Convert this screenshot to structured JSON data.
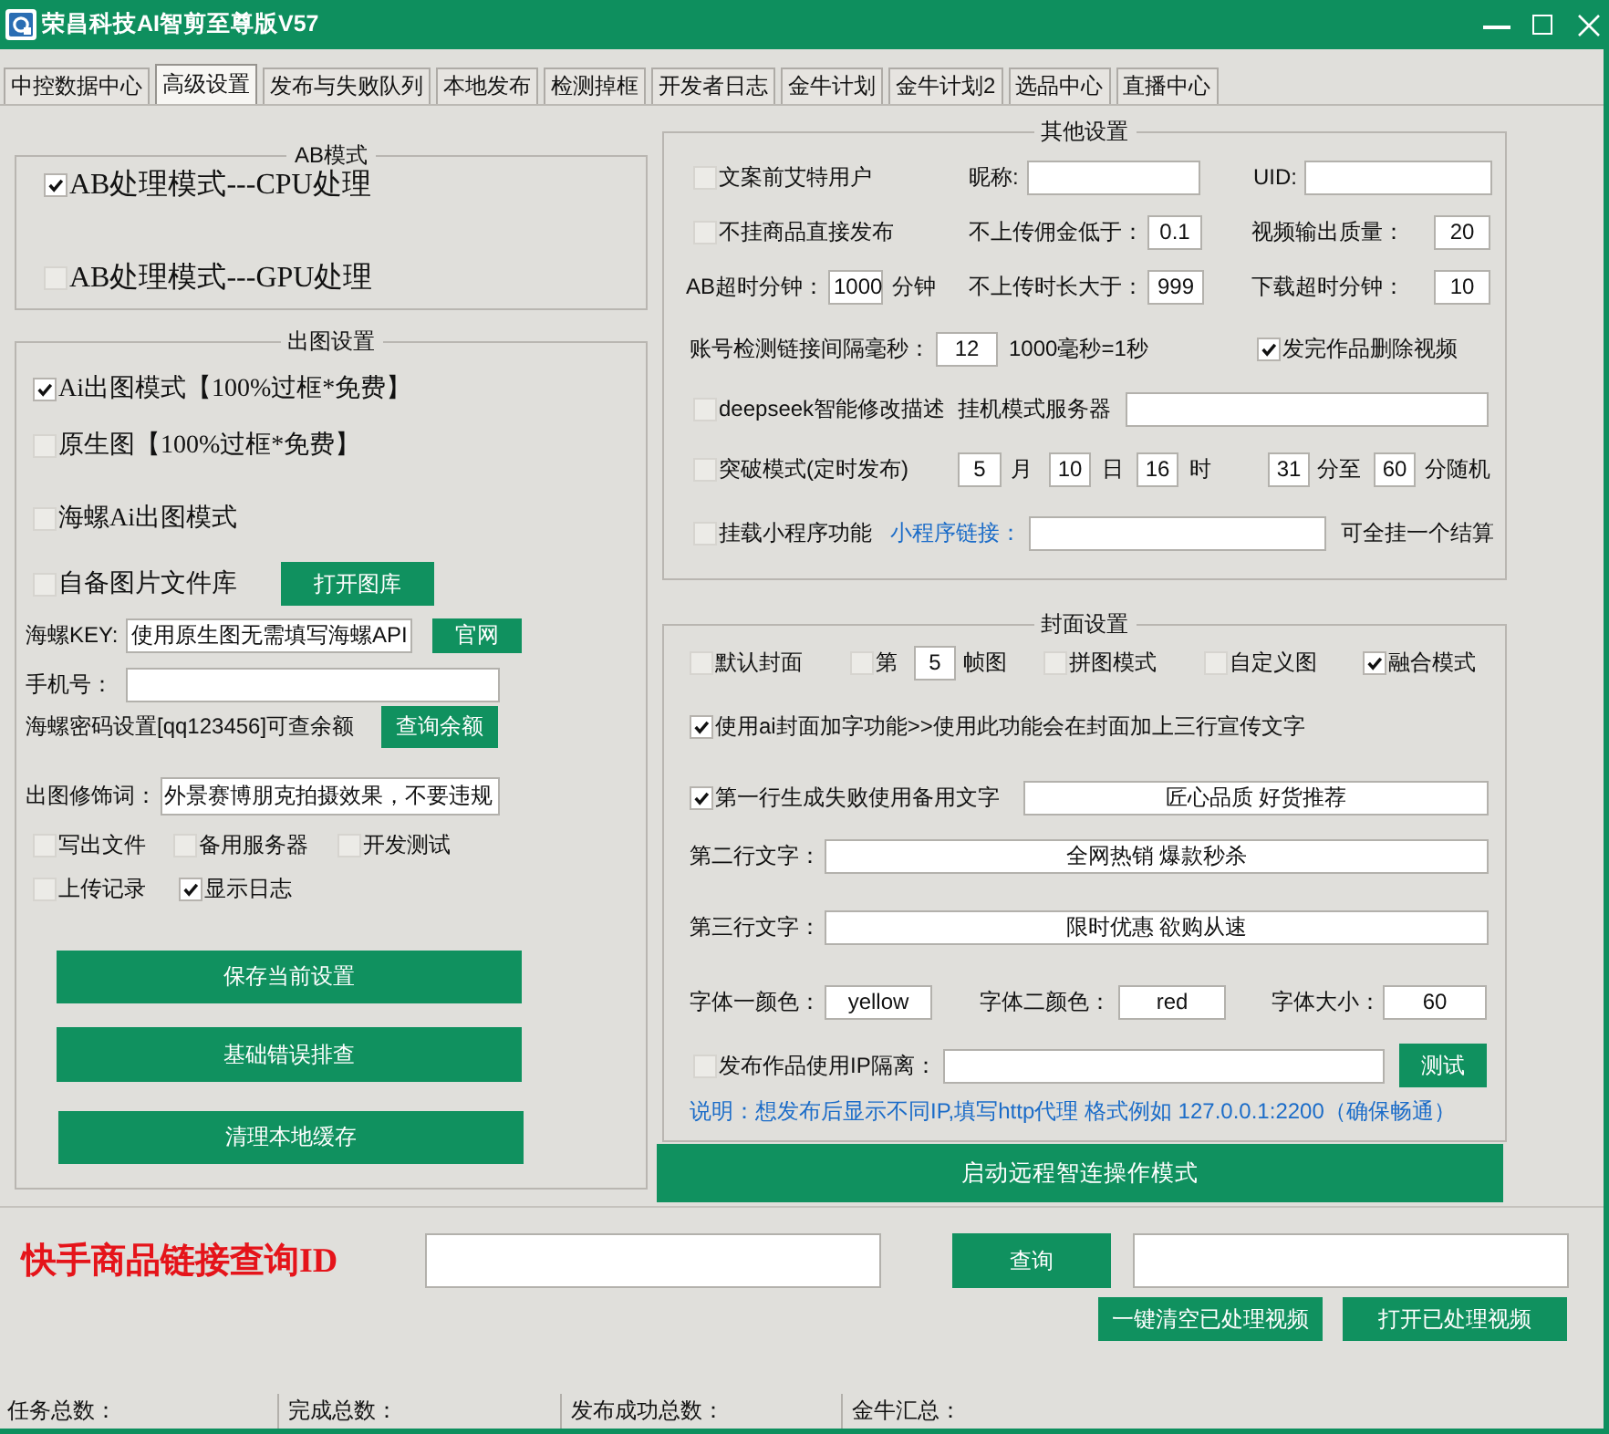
{
  "window": {
    "title": "荣昌科技AI智剪至尊版V57"
  },
  "tabs": [
    {
      "label": "中控数据中心",
      "selected": false
    },
    {
      "label": "高级设置",
      "selected": true
    },
    {
      "label": "发布与失败队列",
      "selected": false
    },
    {
      "label": "本地发布",
      "selected": false
    },
    {
      "label": "检测掉框",
      "selected": false
    },
    {
      "label": "开发者日志",
      "selected": false
    },
    {
      "label": "金牛计划",
      "selected": false
    },
    {
      "label": "金牛计划2",
      "selected": false
    },
    {
      "label": "选品中心",
      "selected": false
    },
    {
      "label": "直播中心",
      "selected": false
    }
  ],
  "ab_mode": {
    "title": "AB模式",
    "options": [
      {
        "label": "AB处理模式---CPU处理",
        "checked": true
      },
      {
        "label": "AB处理模式---GPU处理",
        "checked": false
      }
    ]
  },
  "image_settings": {
    "title": "出图设置",
    "modes": [
      {
        "label": "Ai出图模式【100%过框*免费】",
        "checked": true
      },
      {
        "label": "原生图【100%过框*免费】",
        "checked": false
      },
      {
        "label": "海螺Ai出图模式",
        "checked": false
      },
      {
        "label": "自备图片文件库",
        "checked": false,
        "button": "打开图库"
      }
    ],
    "key": {
      "label": "海螺KEY:",
      "value": "使用原生图无需填写海螺API",
      "button": "官网"
    },
    "phone": {
      "label": "手机号："
    },
    "password": {
      "text": "海螺密码设置[qq123456]可查余额",
      "button": "查询余额"
    },
    "prompt": {
      "label": "出图修饰词：",
      "value": "外景赛博朋克拍摄效果，不要违规"
    },
    "option_rows": [
      [
        {
          "label": "写出文件",
          "checked": false
        },
        {
          "label": "备用服务器",
          "checked": false
        },
        {
          "label": "开发测试",
          "checked": false
        }
      ],
      [
        {
          "label": "上传记录",
          "checked": false
        },
        {
          "label": "显示日志",
          "checked": true
        }
      ]
    ],
    "buttons": [
      "保存当前设置",
      "基础错误排查",
      "清理本地缓存"
    ]
  },
  "other_settings": {
    "title": "其他设置",
    "lines": [
      {
        "items": [
          {
            "kind": "checkbox",
            "label": "文案前艾特用户",
            "checked": false
          },
          {
            "kind": "label",
            "text": "昵称:"
          },
          {
            "kind": "field"
          },
          {
            "kind": "label",
            "text": "UID:"
          },
          {
            "kind": "field"
          }
        ]
      },
      {
        "items": [
          {
            "kind": "checkbox",
            "label": "不挂商品直接发布",
            "checked": false
          },
          {
            "kind": "label",
            "text": "不上传佣金低于："
          },
          {
            "kind": "field",
            "value": "0.1"
          },
          {
            "kind": "label",
            "text": "视频输出质量："
          },
          {
            "kind": "field",
            "value": "20"
          }
        ]
      },
      {
        "items": [
          {
            "kind": "label",
            "text": "AB超时分钟："
          },
          {
            "kind": "field",
            "value": "1000"
          },
          {
            "kind": "label",
            "text": "分钟"
          },
          {
            "kind": "label",
            "text": "不上传时长大于："
          },
          {
            "kind": "field",
            "value": "999"
          },
          {
            "kind": "label",
            "text": "下载超时分钟："
          },
          {
            "kind": "field",
            "value": "10"
          }
        ]
      },
      {
        "items": [
          {
            "kind": "label",
            "text": "账号检测链接间隔毫秒："
          },
          {
            "kind": "field",
            "value": "12"
          },
          {
            "kind": "label",
            "text": "1000毫秒=1秒"
          },
          {
            "kind": "checkbox",
            "label": "发完作品删除视频",
            "checked": true
          }
        ]
      },
      {
        "items": [
          {
            "kind": "checkbox",
            "label": "deepseek智能修改描述",
            "checked": false
          },
          {
            "kind": "label",
            "text": "挂机模式服务器"
          },
          {
            "kind": "field"
          }
        ]
      },
      {
        "items": [
          {
            "kind": "checkbox",
            "label": "突破模式(定时发布)",
            "checked": false
          },
          {
            "kind": "field",
            "value": "5"
          },
          {
            "kind": "label",
            "text": "月"
          },
          {
            "kind": "field",
            "value": "10"
          },
          {
            "kind": "label",
            "text": "日"
          },
          {
            "kind": "field",
            "value": "16"
          },
          {
            "kind": "label",
            "text": "时"
          },
          {
            "kind": "field",
            "value": "31"
          },
          {
            "kind": "label",
            "text": "分至"
          },
          {
            "kind": "field",
            "value": "60"
          },
          {
            "kind": "label",
            "text": "分随机"
          }
        ]
      },
      {
        "items": [
          {
            "kind": "checkbox",
            "label": "挂载小程序功能",
            "checked": false
          },
          {
            "kind": "note",
            "text": "小程序链接："
          },
          {
            "kind": "field"
          },
          {
            "kind": "label",
            "text": "可全挂一个结算"
          }
        ]
      }
    ]
  },
  "cover_settings": {
    "title": "封面设置",
    "lines": [
      {
        "items": [
          {
            "kind": "checkbox",
            "label": "默认封面",
            "checked": false
          },
          {
            "kind": "checkbox",
            "label": "第",
            "checked": false
          },
          {
            "kind": "field",
            "value": "5"
          },
          {
            "kind": "label",
            "text": "帧图"
          },
          {
            "kind": "checkbox",
            "label": "拼图模式",
            "checked": false
          },
          {
            "kind": "checkbox",
            "label": "自定义图",
            "checked": false
          },
          {
            "kind": "checkbox",
            "label": "融合模式",
            "checked": true
          }
        ]
      },
      {
        "items": [
          {
            "kind": "checkbox",
            "label": "使用ai封面加字功能>>使用此功能会在封面加上三行宣传文字",
            "checked": true
          }
        ]
      },
      {
        "items": [
          {
            "kind": "checkbox",
            "label": "第一行生成失败使用备用文字",
            "checked": true
          },
          {
            "kind": "field",
            "value": "匠心品质 好货推荐"
          }
        ]
      },
      {
        "items": [
          {
            "kind": "label",
            "text": "第二行文字："
          },
          {
            "kind": "field",
            "value": "全网热销 爆款秒杀"
          }
        ]
      },
      {
        "items": [
          {
            "kind": "label",
            "text": "第三行文字："
          },
          {
            "kind": "field",
            "value": "限时优惠 欲购从速"
          }
        ]
      },
      {
        "items": [
          {
            "kind": "label",
            "text": "字体一颜色："
          },
          {
            "kind": "field",
            "value": "yellow"
          },
          {
            "kind": "label",
            "text": "字体二颜色："
          },
          {
            "kind": "field",
            "value": "red"
          },
          {
            "kind": "label",
            "text": "字体大小："
          },
          {
            "kind": "field",
            "value": "60"
          }
        ]
      },
      {
        "items": [
          {
            "kind": "checkbox",
            "label": "发布作品使用IP隔离：",
            "checked": false
          },
          {
            "kind": "field"
          },
          {
            "kind": "button",
            "text": "测试"
          }
        ]
      },
      {
        "items": [
          {
            "kind": "note",
            "text": "说明：想发布后显示不同IP,填写http代理 格式例如 127.0.0.1:2200（确保畅通）"
          }
        ]
      }
    ]
  },
  "remote_button": "启动远程智连操作模式",
  "query": {
    "title": "快手商品链接查询ID",
    "button": "查询",
    "buttons": [
      "一键清空已处理视频",
      "打开已处理视频"
    ]
  },
  "status_bar": [
    "任务总数：",
    "完成总数：",
    "发布成功总数：",
    "金牛汇总："
  ]
}
